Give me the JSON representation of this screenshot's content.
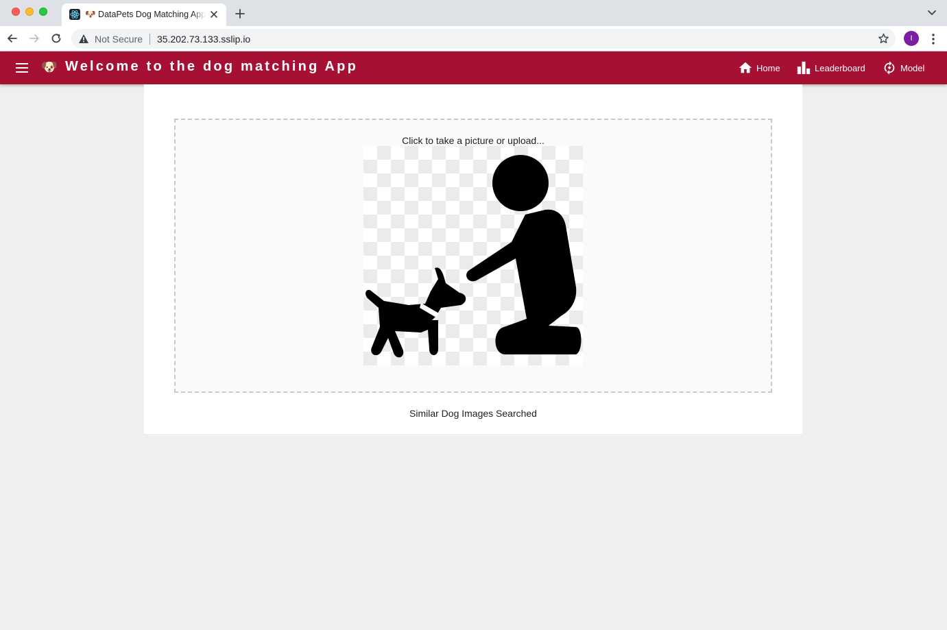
{
  "browser": {
    "tab_title": "🐶 DataPets Dog Matching App",
    "security_label": "Not Secure",
    "url": "35.202.73.133.sslip.io",
    "profile_initial": "I"
  },
  "appbar": {
    "logo_emoji": "🐶",
    "title": "Welcome to the dog matching App",
    "nav": [
      {
        "label": "Home",
        "icon": "home-icon"
      },
      {
        "label": "Leaderboard",
        "icon": "leaderboard-icon"
      },
      {
        "label": "Model",
        "icon": "model-icon"
      }
    ]
  },
  "upload": {
    "prompt": "Click to take a picture or upload...",
    "placeholder_image": "person-with-dog-icon"
  },
  "results": {
    "heading": "Similar Dog Images Searched"
  },
  "colors": {
    "appbar": "#a51033",
    "background": "#efefef",
    "panel": "#ffffff"
  }
}
